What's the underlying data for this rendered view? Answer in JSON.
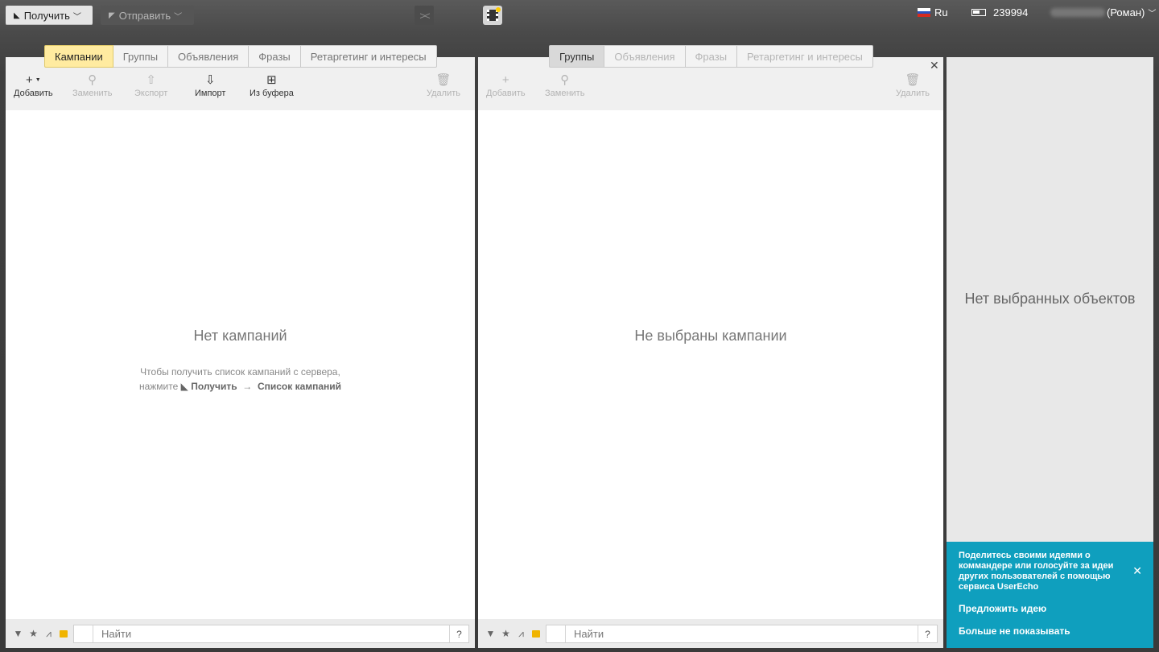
{
  "topbar": {
    "get_label": "Получить",
    "send_label": "Отправить",
    "lang": "Ru",
    "points": "239994",
    "user_suffix": "(Роман)"
  },
  "left_panel": {
    "tabs": [
      "Кампании",
      "Группы",
      "Объявления",
      "Фразы",
      "Ретаргетинг и интересы"
    ],
    "toolbar": {
      "add": "Добавить",
      "replace": "Заменить",
      "export": "Экспорт",
      "import": "Импорт",
      "from_clipboard": "Из буфера",
      "delete": "Удалить"
    },
    "empty_title": "Нет кампаний",
    "hint_line1": "Чтобы получить список кампаний с сервера,",
    "hint_press": "нажмите",
    "hint_get": "Получить",
    "hint_arrow": "→",
    "hint_list": "Список кампаний",
    "search_placeholder": "Найти",
    "help": "?"
  },
  "middle_panel": {
    "tabs": [
      "Группы",
      "Объявления",
      "Фразы",
      "Ретаргетинг и интересы"
    ],
    "toolbar": {
      "add": "Добавить",
      "replace": "Заменить",
      "delete": "Удалить"
    },
    "empty_title": "Не выбраны кампании",
    "search_placeholder": "Найти",
    "help": "?"
  },
  "right_panel": {
    "empty_title": "Нет выбранных объектов"
  },
  "userecho": {
    "message": "Поделитесь своими идеями о коммандере или голосуйте за идеи других пользователей с помощью сервиса UserEcho",
    "suggest": "Предложить идею",
    "dont_show": "Больше не показывать"
  },
  "colors": {
    "active_tab": "#ffeba0",
    "userecho_bg": "#0f9fbe",
    "folder_icon": "#f0b400"
  }
}
